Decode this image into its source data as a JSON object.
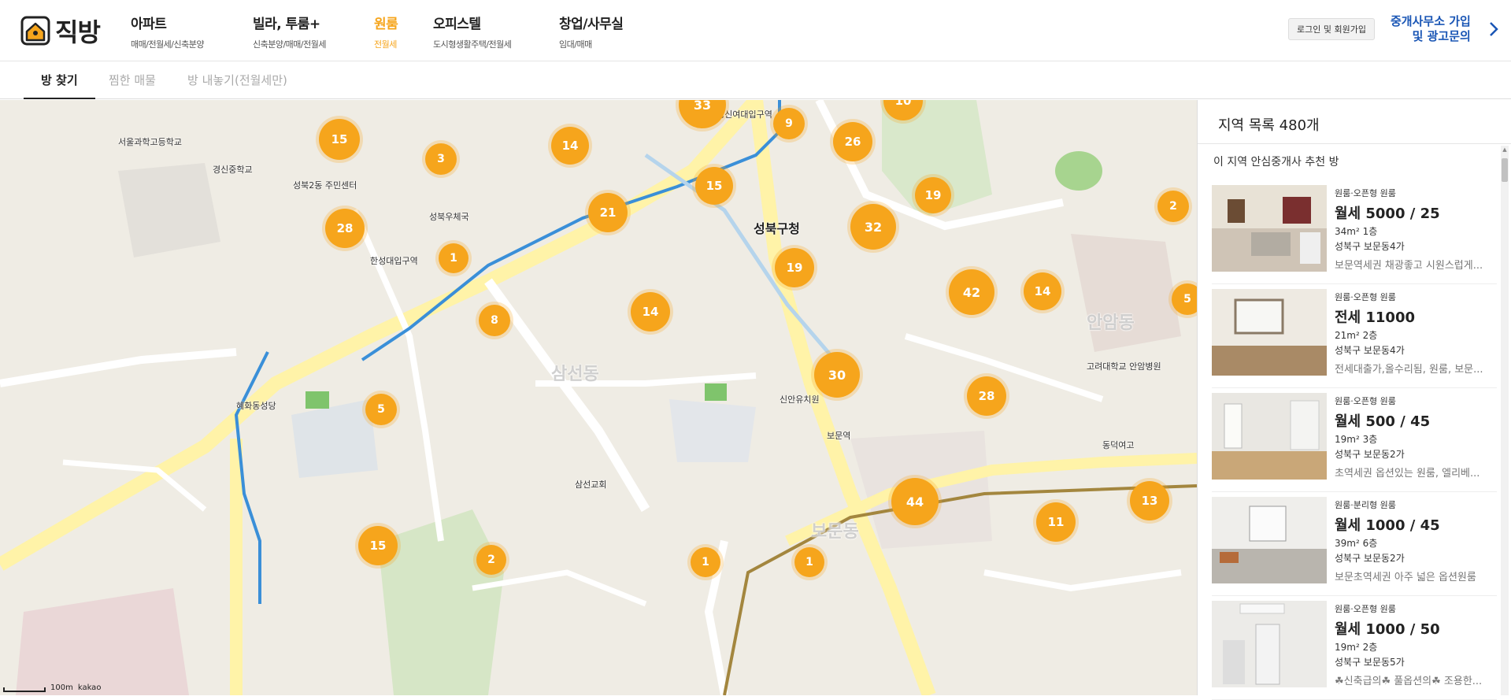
{
  "header": {
    "logo_text": "직방",
    "nav": [
      {
        "title": "아파트",
        "sub": "매매/전월세/신축분양"
      },
      {
        "title": "빌라, 투룸+",
        "sub": "신축분양/매매/전월세"
      },
      {
        "title": "원룸",
        "sub": "전월세",
        "active": true
      },
      {
        "title": "오피스텔",
        "sub": "도시형생활주택/전월세"
      },
      {
        "title": "창업/사무실",
        "sub": "임대/매매"
      }
    ],
    "login_label": "로그인 및 회원가입",
    "broker_line1": "중개사무소 가입",
    "broker_line2": "및 광고문의"
  },
  "tabs": [
    "방 찾기",
    "찜한 매물",
    "방 내놓기(전월세만)"
  ],
  "map": {
    "clusters": [
      "15",
      "3",
      "14",
      "33",
      "9",
      "26",
      "10",
      "15",
      "21",
      "28",
      "1",
      "19",
      "32",
      "2",
      "19",
      "42",
      "14",
      "5",
      "8",
      "14",
      "30",
      "28",
      "5",
      "44",
      "13",
      "11",
      "15",
      "2",
      "1",
      "1"
    ],
    "labels": [
      "성북구청",
      "삼선동",
      "보문동",
      "안암동",
      "성북2동 주민센터",
      "한성대입구역",
      "보문역",
      "성신여대입구역",
      "서울과학고등학교",
      "경신중학교",
      "삼선교회",
      "혜화동성당",
      "성북우체국",
      "고려대학교 안암병원",
      "동덕여고",
      "신안유치원"
    ],
    "scale_text": "100m",
    "brand": "kakao"
  },
  "panel": {
    "title": "지역 목록 480개",
    "subtitle": "이 지역 안심중개사 추천 방",
    "listings": [
      {
        "kind": "원룸·오픈형 원룸",
        "price": "월세 5000 / 25",
        "area": "34m² 1층",
        "addr": "성북구 보문동4가",
        "desc": "보문역세권 채광좋고 시원스럽게..."
      },
      {
        "kind": "원룸·오픈형 원룸",
        "price": "전세 11000",
        "area": "21m² 2층",
        "addr": "성북구 보문동4가",
        "desc": "전세대출가,올수리됨, 원룸, 보문..."
      },
      {
        "kind": "원룸·오픈형 원룸",
        "price": "월세 500 / 45",
        "area": "19m² 3층",
        "addr": "성북구 보문동2가",
        "desc": "초역세권 옵션있는 원룸, 엘리베..."
      },
      {
        "kind": "원룸·분리형 원룸",
        "price": "월세 1000 / 45",
        "area": "39m² 6층",
        "addr": "성북구 보문동2가",
        "desc": "보문초역세권 아주 넓은 옵션원룸"
      },
      {
        "kind": "원룸·오픈형 원룸",
        "price": "월세 1000 / 50",
        "area": "19m² 2층",
        "addr": "성북구 보문동5가",
        "desc": "☘신축급의☘ 풀옵션의☘ 조용한..."
      }
    ]
  },
  "colors": {
    "accent": "#f6a51c",
    "link": "#1a56b5",
    "road_major": "#fff5b8",
    "road": "#ffffff",
    "park": "#cfe5c0",
    "water": "#b5d4ec"
  }
}
